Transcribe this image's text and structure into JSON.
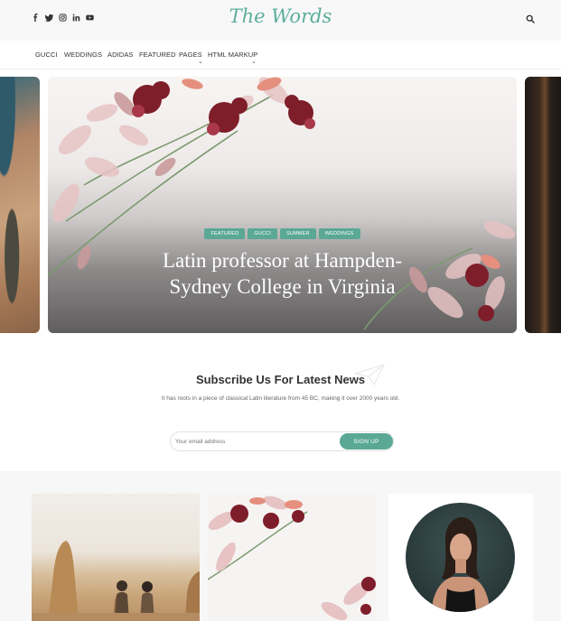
{
  "header": {
    "logo": "The Words",
    "social_icons": [
      "facebook-icon",
      "twitter-icon",
      "instagram-icon",
      "linkedin-icon",
      "youtube-icon"
    ],
    "search_icon": "search-icon"
  },
  "nav": {
    "items": [
      {
        "label": "GUCCI"
      },
      {
        "label": "WEDDINGS"
      },
      {
        "label": "ADIDAS"
      },
      {
        "label": "FEATURED"
      },
      {
        "label": "PAGES",
        "dropdown": true
      },
      {
        "label": "HTML MARKUP",
        "dropdown": true
      }
    ],
    "caret": "⌄"
  },
  "hero": {
    "tags": [
      "FEATURED",
      "GUCCI",
      "SUMMER",
      "WEDDINGS"
    ],
    "title_line1": "Latin professor at Hampden-",
    "title_line2": "Sydney College in Virginia"
  },
  "subscribe": {
    "title": "Subscribe Us For Latest News",
    "description": "It has roots in a piece of classical Latin literature from 45 BC, making it over 2000 years old.",
    "email_placeholder": "Your email address",
    "button_label": "SIGN UP"
  },
  "colors": {
    "accent": "#5aa895",
    "logo": "#5cae9a"
  }
}
